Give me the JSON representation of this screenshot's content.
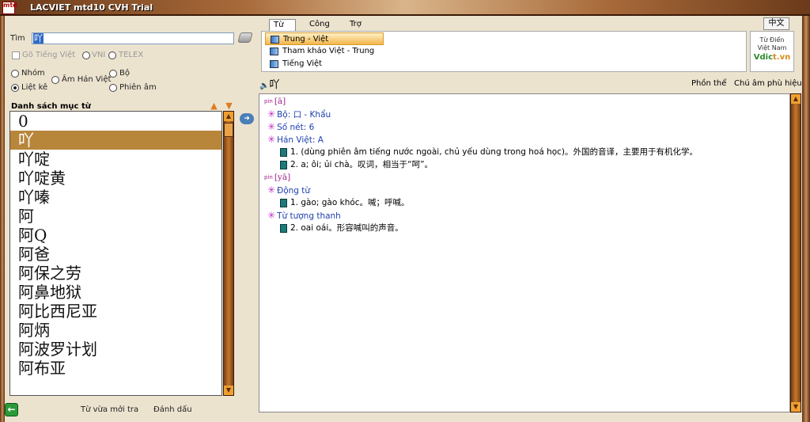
{
  "window": {
    "title": "LACVIET   mtd10 CVH Trial",
    "logo_text": "mtd"
  },
  "search": {
    "label": "Tìm",
    "value": "吖"
  },
  "options": {
    "typing_label": "Gõ Tiếng Việt",
    "vni_label": "VNI",
    "telex_label": "TELEX",
    "group_label": "Nhóm",
    "han_viet_label": "Âm Hán Việt",
    "radical_label": "Bộ",
    "list_label": "Liệt kê",
    "phonetic_label": "Phiên âm"
  },
  "list": {
    "header": "Danh sách mục từ",
    "items": [
      "0",
      "吖",
      "吖啶",
      "吖啶黄",
      "吖嗪",
      "阿",
      "阿Q",
      "阿爸",
      "阿保之劳",
      "阿鼻地狱",
      "阿比西尼亚",
      "阿炳",
      "阿波罗计划",
      "阿布亚"
    ],
    "selected_index": 1
  },
  "bottom": {
    "recent_label": "Từ vừa mởi tra",
    "bookmark_label": "Đánh dấu"
  },
  "tabs": [
    "Từ điển",
    "Công cụ",
    "Trợ giúp"
  ],
  "dictionaries": [
    "Trung - Việt",
    "Tham khảo Việt - Trung",
    "Tiếng Việt"
  ],
  "lang_button": "中文",
  "logo_box": {
    "line1": "Từ Điển",
    "line2": "Việt Nam",
    "brand_a": "Vdic",
    "brand_b": "t.vn"
  },
  "entry": {
    "word": "吖",
    "tool1": "Phồn thể",
    "tool2": "Chú âm phù hiệu",
    "pinyin_tag": "pin",
    "reading1": "[ā]",
    "radical": "Bộ:  口 - Khẩu",
    "strokes": "Số nét: 6",
    "han_viet": "Hán Việt:  A",
    "def1": "1.  (dùng phiên âm tiếng nước ngoài, chủ yếu dùng trong hoá học)。外国的音译，主要用于有机化学。",
    "def2": "2.  a; ôi; ủi chà。叹词，相当于“呵”。",
    "reading2": "[yā]",
    "pos1": "Động từ",
    "def3": "1. gào; gào khóc。喊；呼喊。",
    "pos2": "Từ tượng thanh",
    "def4": "2. oai oái。形容喊叫的声音。"
  }
}
